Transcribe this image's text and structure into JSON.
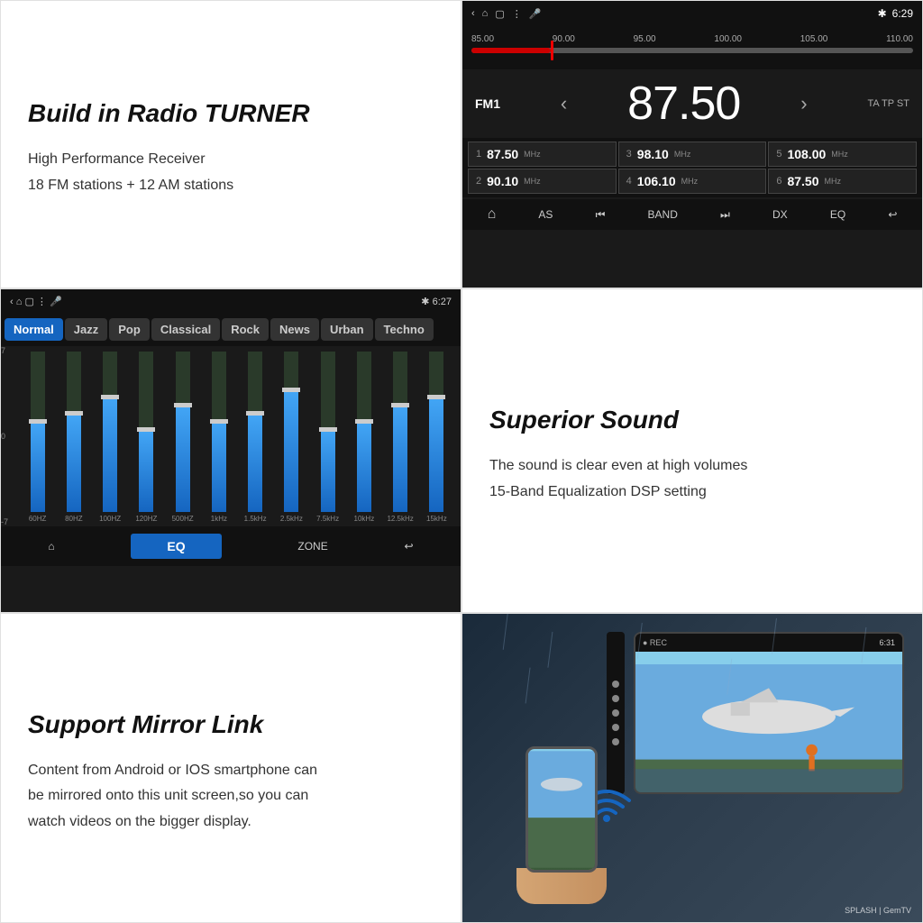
{
  "sections": {
    "radio": {
      "title": "Build in Radio TURNER",
      "desc_line1": "High Performance Receiver",
      "desc_line2": "18 FM stations + 12 AM stations",
      "screen": {
        "time": "6:29",
        "band": "FM1",
        "frequency": "87.50",
        "tuner_labels": [
          "85.00",
          "90.00",
          "95.00",
          "100.00",
          "105.00",
          "110.00"
        ],
        "ta_tp_st": "TA TP ST",
        "presets": [
          {
            "num": "1",
            "freq": "87.50",
            "unit": "MHz"
          },
          {
            "num": "3",
            "freq": "98.10",
            "unit": "MHz"
          },
          {
            "num": "5",
            "freq": "108.00",
            "unit": "MHz"
          },
          {
            "num": "2",
            "freq": "90.10",
            "unit": "MHz"
          },
          {
            "num": "4",
            "freq": "106.10",
            "unit": "MHz"
          },
          {
            "num": "6",
            "freq": "87.50",
            "unit": "MHz"
          }
        ],
        "controls": [
          "🏠",
          "AS",
          "⏮",
          "BAND",
          "⏭",
          "DX",
          "EQ",
          "↩"
        ]
      }
    },
    "eq": {
      "screen": {
        "time": "6:27",
        "modes": [
          "Normal",
          "Jazz",
          "Pop",
          "Classical",
          "Rock",
          "News",
          "Urban",
          "Techno"
        ],
        "active_mode": "Normal",
        "level_labels": [
          "7",
          "0",
          "-7"
        ],
        "bands": [
          {
            "label": "60HZ",
            "fill": 55,
            "handle": 45
          },
          {
            "label": "80HZ",
            "fill": 60,
            "handle": 40
          },
          {
            "label": "100HZ",
            "fill": 70,
            "handle": 30
          },
          {
            "label": "120HZ",
            "fill": 50,
            "handle": 50
          },
          {
            "label": "500HZ",
            "fill": 65,
            "handle": 35
          },
          {
            "label": "1kHz",
            "fill": 55,
            "handle": 45
          },
          {
            "label": "1.5kHz",
            "fill": 60,
            "handle": 40
          },
          {
            "label": "2.5kHz",
            "fill": 75,
            "handle": 25
          },
          {
            "label": "7.5kHz",
            "fill": 50,
            "handle": 50
          },
          {
            "label": "10kHz",
            "fill": 55,
            "handle": 45
          },
          {
            "label": "12.5kHz",
            "fill": 65,
            "handle": 35
          },
          {
            "label": "15kHz",
            "fill": 70,
            "handle": 30
          }
        ],
        "controls_left": "🏠",
        "controls_eq": "EQ",
        "controls_zone": "ZONE",
        "controls_back": "↩"
      }
    },
    "sound": {
      "title": "Superior Sound",
      "desc_line1": "The sound is clear even at high volumes",
      "desc_line2": "15-Band Equalization DSP setting"
    },
    "mirror": {
      "title": "Support Mirror Link",
      "desc_line1": "Content from Android or IOS smartphone can",
      "desc_line2": "be mirrored onto this unit screen,so you can",
      "desc_line3": "watch videos on the  bigger display.",
      "screen": {
        "time": "6:31"
      }
    }
  }
}
